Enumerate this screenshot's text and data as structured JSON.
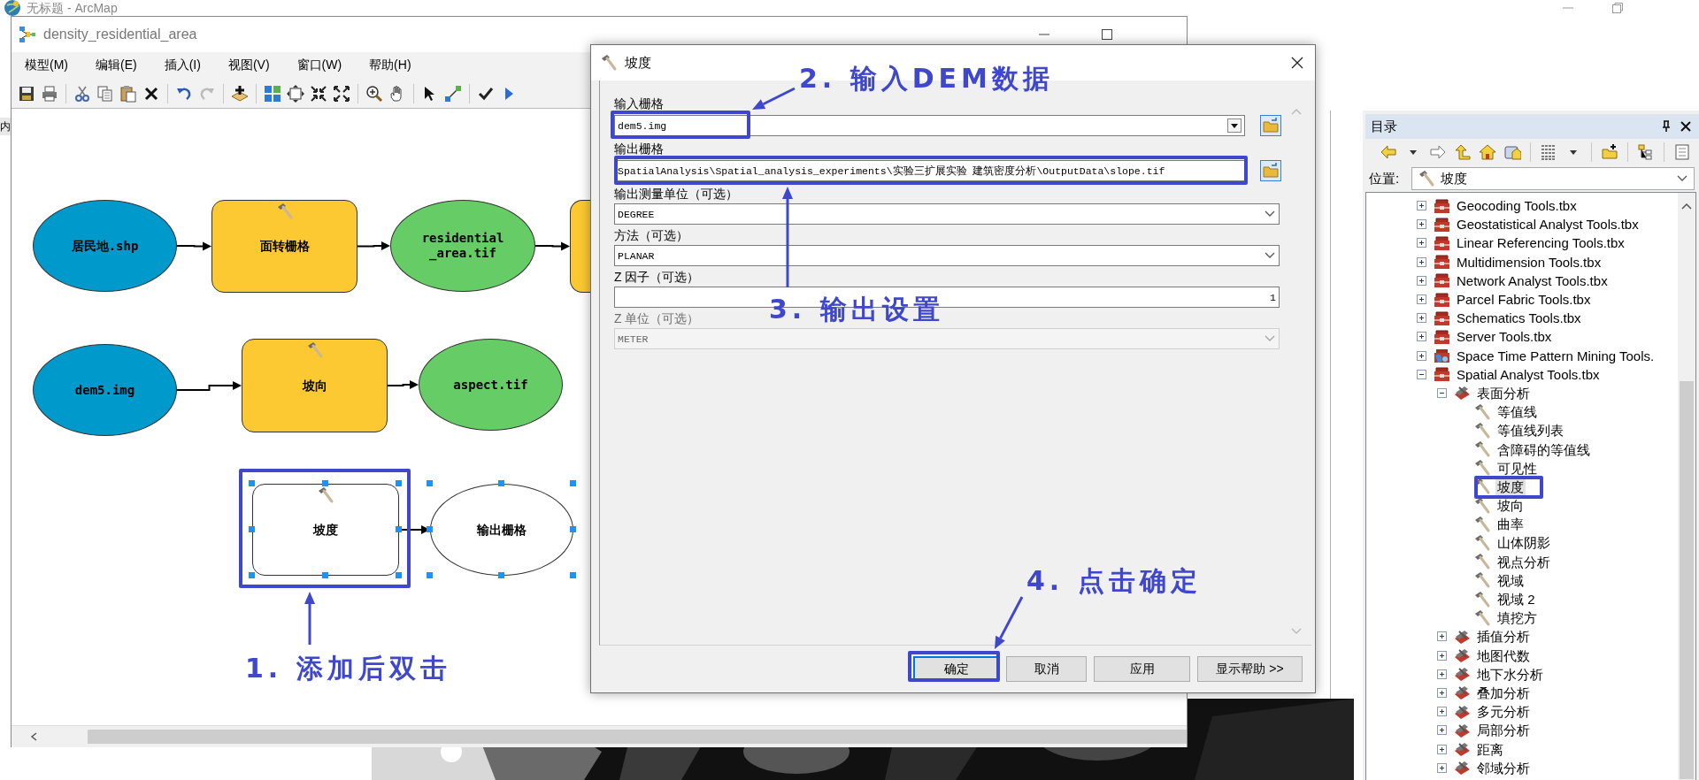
{
  "app_window": {
    "title": "无标题 - ArcMap",
    "side_tab": "内"
  },
  "model_window": {
    "title": "density_residential_area",
    "menu": [
      "模型(M)",
      "编辑(E)",
      "插入(I)",
      "视图(V)",
      "窗口(W)",
      "帮助(H)"
    ],
    "nodes": [
      {
        "kind": "input",
        "label": "居民地.shp",
        "selected": false
      },
      {
        "kind": "tool",
        "label": "面转栅格",
        "selected": false
      },
      {
        "kind": "derived",
        "label": "residential\n_area.tif",
        "selected": false
      },
      {
        "kind": "tool",
        "selected": false
      },
      {
        "kind": "input",
        "label": "dem5.img",
        "selected": false
      },
      {
        "kind": "tool",
        "label": "坡向",
        "selected": false
      },
      {
        "kind": "derived",
        "label": "aspect.tif",
        "selected": false
      },
      {
        "kind": "tool-empty",
        "label": "坡度",
        "selected": true
      },
      {
        "kind": "output-empty",
        "label": "输出栅格",
        "selected": true
      }
    ]
  },
  "dialog": {
    "title": "坡度",
    "params": [
      {
        "kind": "combo",
        "label": "输入栅格",
        "value": "dem5.img",
        "browse": true,
        "disabled": false
      },
      {
        "kind": "text",
        "label": "输出栅格",
        "value": "SpatialAnalysis\\Spatial_analysis_experiments\\实验三扩展实验 建筑密度分析\\OutputData\\slope.tif",
        "browse": true,
        "disabled": false
      },
      {
        "kind": "select",
        "label": "输出测量单位（可选）",
        "value": "DEGREE",
        "browse": false,
        "disabled": false
      },
      {
        "kind": "select",
        "label": "方法（可选）",
        "value": "PLANAR",
        "browse": false,
        "disabled": false
      },
      {
        "kind": "number",
        "label": "Z 因子（可选）",
        "value": "1",
        "browse": false,
        "disabled": false
      },
      {
        "kind": "select",
        "label": "Z 单位（可选）",
        "value": "METER",
        "browse": false,
        "disabled": true
      }
    ],
    "buttons": [
      "确定",
      "取消",
      "应用",
      "显示帮助 >>"
    ]
  },
  "catalog": {
    "title": "目录",
    "location_label": "位置:",
    "location": "坡度",
    "tree": [
      {
        "kind": "toolbox",
        "label": "Geocoding Tools.tbx",
        "expanded": false,
        "selected": false
      },
      {
        "kind": "toolbox",
        "label": "Geostatistical Analyst Tools.tbx",
        "expanded": false,
        "selected": false
      },
      {
        "kind": "toolbox",
        "label": "Linear Referencing Tools.tbx",
        "expanded": false,
        "selected": false
      },
      {
        "kind": "toolbox",
        "label": "Multidimension Tools.tbx",
        "expanded": false,
        "selected": false
      },
      {
        "kind": "toolbox",
        "label": "Network Analyst Tools.tbx",
        "expanded": false,
        "selected": false
      },
      {
        "kind": "toolbox",
        "label": "Parcel Fabric Tools.tbx",
        "expanded": false,
        "selected": false
      },
      {
        "kind": "toolbox",
        "label": "Schematics Tools.tbx",
        "expanded": false,
        "selected": false
      },
      {
        "kind": "toolbox",
        "label": "Server Tools.tbx",
        "expanded": false,
        "selected": false
      },
      {
        "kind": "toolbox-alt",
        "label": "Space Time Pattern Mining Tools.",
        "expanded": false,
        "selected": false
      },
      {
        "kind": "toolbox",
        "label": "Spatial Analyst Tools.tbx",
        "expanded": true,
        "selected": false,
        "children": [
          {
            "kind": "toolset",
            "label": "表面分析",
            "expanded": true,
            "selected": false,
            "children": [
              {
                "kind": "tool",
                "label": "等值线",
                "selected": false
              },
              {
                "kind": "tool",
                "label": "等值线列表",
                "selected": false
              },
              {
                "kind": "tool",
                "label": "含障碍的等值线",
                "selected": false
              },
              {
                "kind": "tool",
                "label": "可见性",
                "selected": false
              },
              {
                "kind": "tool",
                "label": "坡度",
                "selected": true
              },
              {
                "kind": "tool",
                "label": "坡向",
                "selected": false
              },
              {
                "kind": "tool",
                "label": "曲率",
                "selected": false
              },
              {
                "kind": "tool",
                "label": "山体阴影",
                "selected": false
              },
              {
                "kind": "tool",
                "label": "视点分析",
                "selected": false
              },
              {
                "kind": "tool",
                "label": "视域",
                "selected": false
              },
              {
                "kind": "tool",
                "label": "视域 2",
                "selected": false
              },
              {
                "kind": "tool",
                "label": "填挖方",
                "selected": false
              }
            ]
          },
          {
            "kind": "toolset",
            "label": "插值分析",
            "expanded": false,
            "selected": false
          },
          {
            "kind": "toolset",
            "label": "地图代数",
            "expanded": false,
            "selected": false
          },
          {
            "kind": "toolset",
            "label": "地下水分析",
            "expanded": false,
            "selected": false
          },
          {
            "kind": "toolset",
            "label": "叠加分析",
            "expanded": false,
            "selected": false
          },
          {
            "kind": "toolset",
            "label": "多元分析",
            "expanded": false,
            "selected": false
          },
          {
            "kind": "toolset",
            "label": "局部分析",
            "expanded": false,
            "selected": false
          },
          {
            "kind": "toolset",
            "label": "距离",
            "expanded": false,
            "selected": false
          },
          {
            "kind": "toolset",
            "label": "邻域分析",
            "expanded": false,
            "selected": false
          }
        ]
      }
    ]
  },
  "annotations": [
    {
      "text": "1. 添加后双击"
    },
    {
      "text": "2. 输入DEM数据"
    },
    {
      "text": "3. 输出设置"
    },
    {
      "text": "4. 点击确定"
    }
  ]
}
